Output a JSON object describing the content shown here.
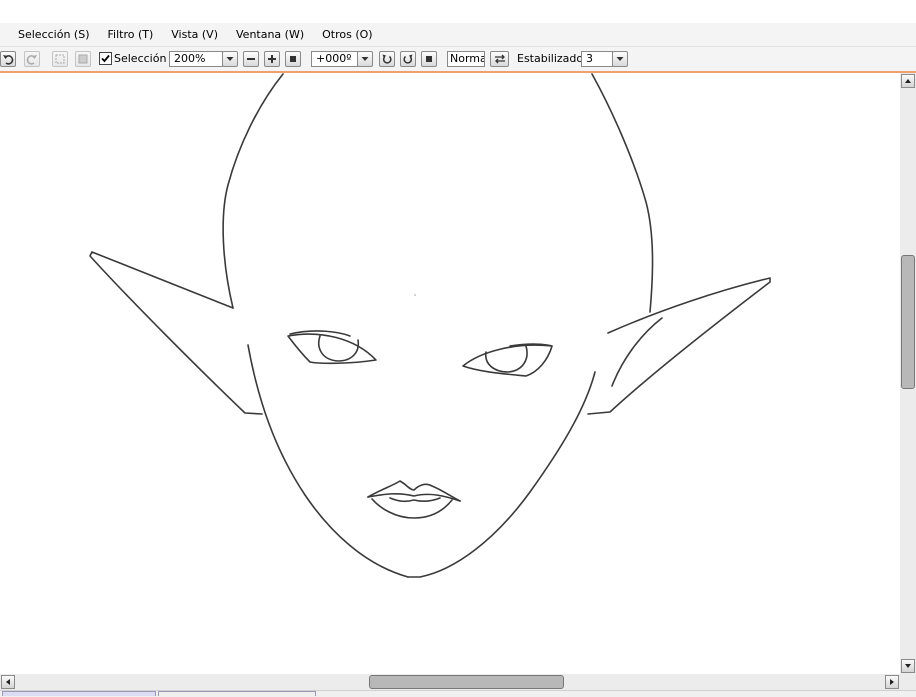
{
  "menu": {
    "items": [
      {
        "label": "Selección (S)"
      },
      {
        "label": "Filtro (T)"
      },
      {
        "label": "Vista (V)"
      },
      {
        "label": "Ventana (W)"
      },
      {
        "label": "Otros (O)"
      }
    ]
  },
  "toolbar": {
    "selection_label": "Selección",
    "selection_checked": true,
    "zoom_value": "200%",
    "rotation_value": "+000º",
    "blend_mode": "Normal",
    "stabilizer_label": "Estabilizador",
    "stabilizer_value": "3",
    "icons": [
      "undo-icon",
      "redo-icon",
      "deselect-icon",
      "invert-selection-icon",
      "zoom-out-icon",
      "zoom-in-icon",
      "zoom-reset-icon",
      "rotate-left-icon",
      "rotate-right-icon",
      "rotate-reset-icon",
      "flip-horizontal-icon"
    ]
  },
  "colors": {
    "accent_line": "#f0a070",
    "chrome": "#f4f4f4",
    "canvas": "#ffffff",
    "ink": "#3a3a3a"
  }
}
